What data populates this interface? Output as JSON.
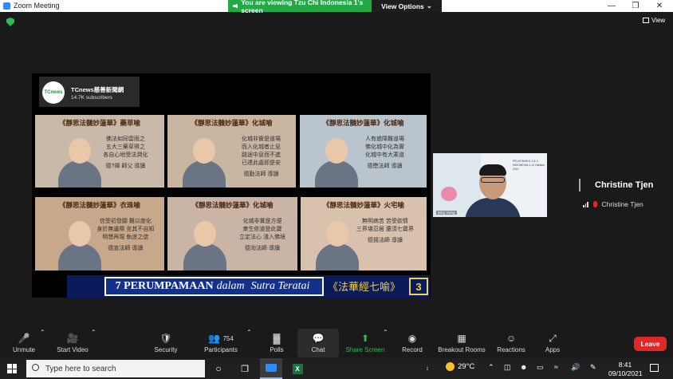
{
  "window": {
    "title": "Zoom Meeting"
  },
  "share": {
    "banner": "You are viewing Tzu Chi Indonesia 1's screen",
    "view_options": "View Options"
  },
  "view_button": "View",
  "video": {
    "channel_name": "TCnews慈善新聞網",
    "channel_subs": "14.7K subscribers",
    "channel_logo": "TCnews",
    "thumbnails": [
      {
        "title": "《靜思法髓妙蓮華》藥草喻",
        "lines": [
          "佛法如同雲雨之",
          "五大三藥草得之",
          "各自心地受法潤化"
        ],
        "sig": "德?禪 師父 導讀",
        "bg": "#c9b9a8"
      },
      {
        "title": "《靜思法髓妙蓮華》化城喻",
        "lines": [
          "化城非實是道場",
          "而入化城者止息",
          "路途中息而不進",
          "已達此處即是安"
        ],
        "sig": "德勤法師 導讀",
        "bg": "#c8b6a2"
      },
      {
        "title": "《靜思法髓妙蓮華》化城喻",
        "lines": [
          "人有惑障難道場",
          "佛化城中化為實",
          "化城中有大乘道"
        ],
        "sig": "德懋法師 導讀",
        "bg": "#b9c4cc"
      },
      {
        "title": "《靜思法髓妙蓮華》衣珠喻",
        "lines": [
          "信受初發願 難以度化",
          "身於無邊際 坐其不自知",
          "明慧再現 執迷之徒"
        ],
        "sig": "德宣法師 導讀",
        "bg": "#c8a88a"
      },
      {
        "title": "《靜思法髓妙蓮華》化城喻",
        "lines": [
          "化城非實是方便",
          "衆生依道登此寶",
          "立定法心 淺入佛境"
        ],
        "sig": "德洵法師 導讀",
        "bg": "#c9b4a6"
      },
      {
        "title": "《靜思法髓妙蓮華》火宅喻",
        "lines": [
          "無明病苦 苦受欲情",
          "三界堪忍居 還須七寶界"
        ],
        "sig": "德揚法師 導讀",
        "bg": "#d8c2ae"
      }
    ],
    "banner_text_a": "7 PERUMPAMAAN",
    "banner_text_b": "dalam",
    "banner_text_c": "Sutra Teratai",
    "banner_cn": "《法華經七喻》",
    "banner_num": "3"
  },
  "participant": {
    "name": "Christine Tjen",
    "tile_label": "Bing Yiang",
    "banner_text": "PELATIHAN K.3 & 4 INDONESIA 4-10 Oktober 2021"
  },
  "toolbar": {
    "unmute": "Unmute",
    "start_video": "Start Video",
    "security": "Security",
    "participants": "Participants",
    "participants_count": "754",
    "polls": "Polls",
    "chat": "Chat",
    "share_screen": "Share Screen",
    "record": "Record",
    "breakout": "Breakout Rooms",
    "reactions": "Reactions",
    "apps": "Apps",
    "leave": "Leave"
  },
  "taskbar": {
    "search_placeholder": "Type here to search",
    "temperature": "29°C",
    "time": "8:41",
    "date": "09/10/2021"
  }
}
